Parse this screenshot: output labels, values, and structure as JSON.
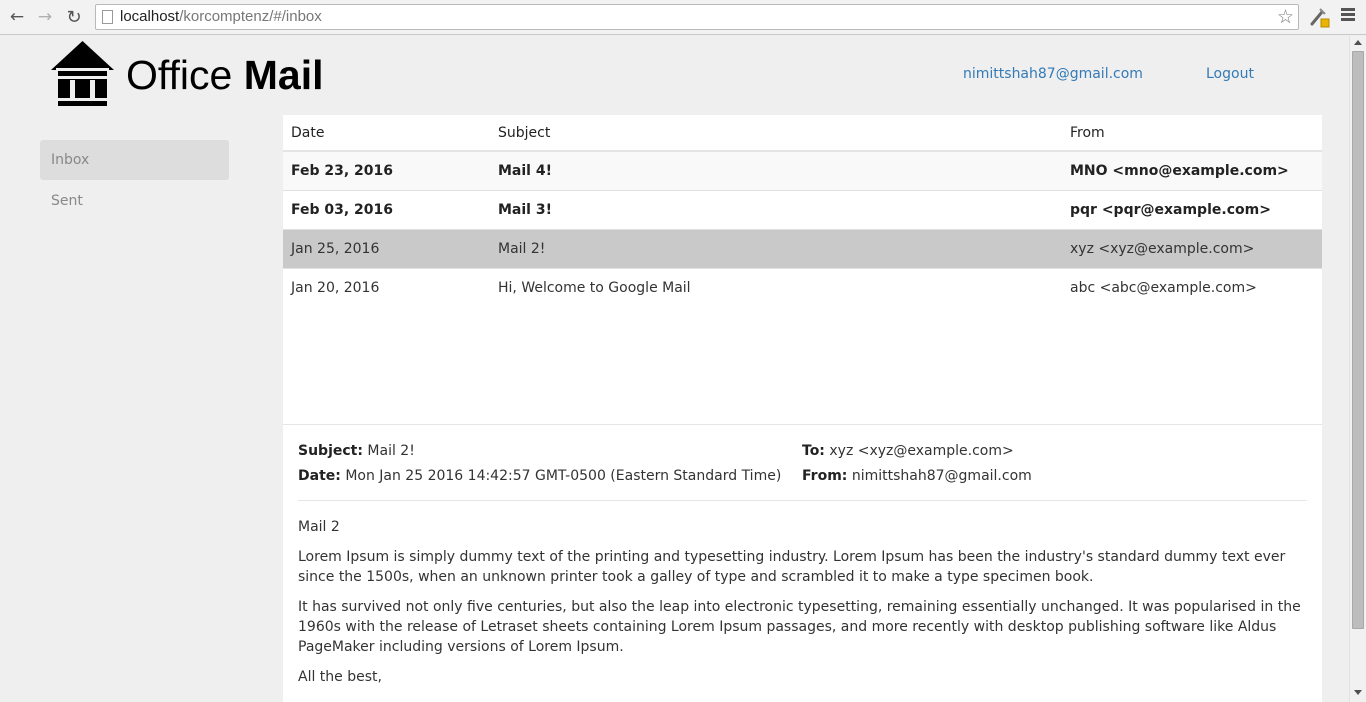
{
  "browser": {
    "url_host": "localhost",
    "url_path": "/korcomptenz/#/inbox"
  },
  "header": {
    "brand_regular": "Office",
    "brand_bold": "Mail",
    "user_email": "nimittshah87@gmail.com",
    "logout_label": "Logout"
  },
  "sidebar": {
    "items": [
      {
        "label": "Inbox",
        "active": true
      },
      {
        "label": "Sent",
        "active": false
      }
    ]
  },
  "table": {
    "headers": [
      "Date",
      "Subject",
      "From"
    ],
    "rows": [
      {
        "date": "Feb 23, 2016",
        "subject": "Mail 4!",
        "from": "MNO <mno@example.com>"
      },
      {
        "date": "Feb 03, 2016",
        "subject": "Mail 3!",
        "from": "pqr <pqr@example.com>"
      },
      {
        "date": "Jan 25, 2016",
        "subject": "Mail 2!",
        "from": "xyz <xyz@example.com>"
      },
      {
        "date": "Jan 20, 2016",
        "subject": "Hi, Welcome to Google Mail",
        "from": "abc <abc@example.com>"
      }
    ]
  },
  "message": {
    "subject_label": "Subject:",
    "subject": "Mail 2!",
    "date_label": "Date:",
    "date": "Mon Jan 25 2016 14:42:57 GMT-0500 (Eastern Standard Time)",
    "to_label": "To:",
    "to": "xyz <xyz@example.com>",
    "from_label": "From:",
    "from": "nimittshah87@gmail.com",
    "body": [
      "Mail 2",
      "Lorem Ipsum is simply dummy text of the printing and typesetting industry. Lorem Ipsum has been the industry's standard dummy text ever since the 1500s, when an unknown printer took a galley of type and scrambled it to make a type specimen book.",
      "It has survived not only five centuries, but also the leap into electronic typesetting, remaining essentially unchanged. It was popularised in the 1960s with the release of Letraset sheets containing Lorem Ipsum passages, and more recently with desktop publishing software like Aldus PageMaker including versions of Lorem Ipsum.",
      "All the best,"
    ]
  },
  "colors": {
    "link": "#337ab7",
    "selected_row": "#c9c9c9",
    "page_background": "#efefef"
  }
}
